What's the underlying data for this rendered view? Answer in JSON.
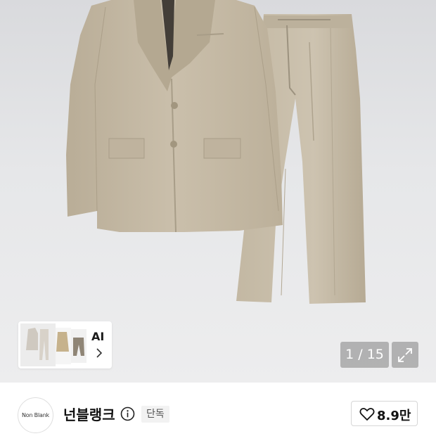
{
  "gallery": {
    "counter": "1 / 15",
    "current_image": 1,
    "total_images": 15,
    "ai_label": "AI",
    "background": "#e4e5e7",
    "product_color": "#c8bca7"
  },
  "brand": {
    "avatar_text": "Non Blank",
    "name": "넌블랭크",
    "badge": "단독"
  },
  "like": {
    "count": "8.9만"
  },
  "icons": {
    "info": "info-icon",
    "expand": "expand-icon",
    "chevron": "chevron-right-icon",
    "heart": "heart-icon"
  }
}
